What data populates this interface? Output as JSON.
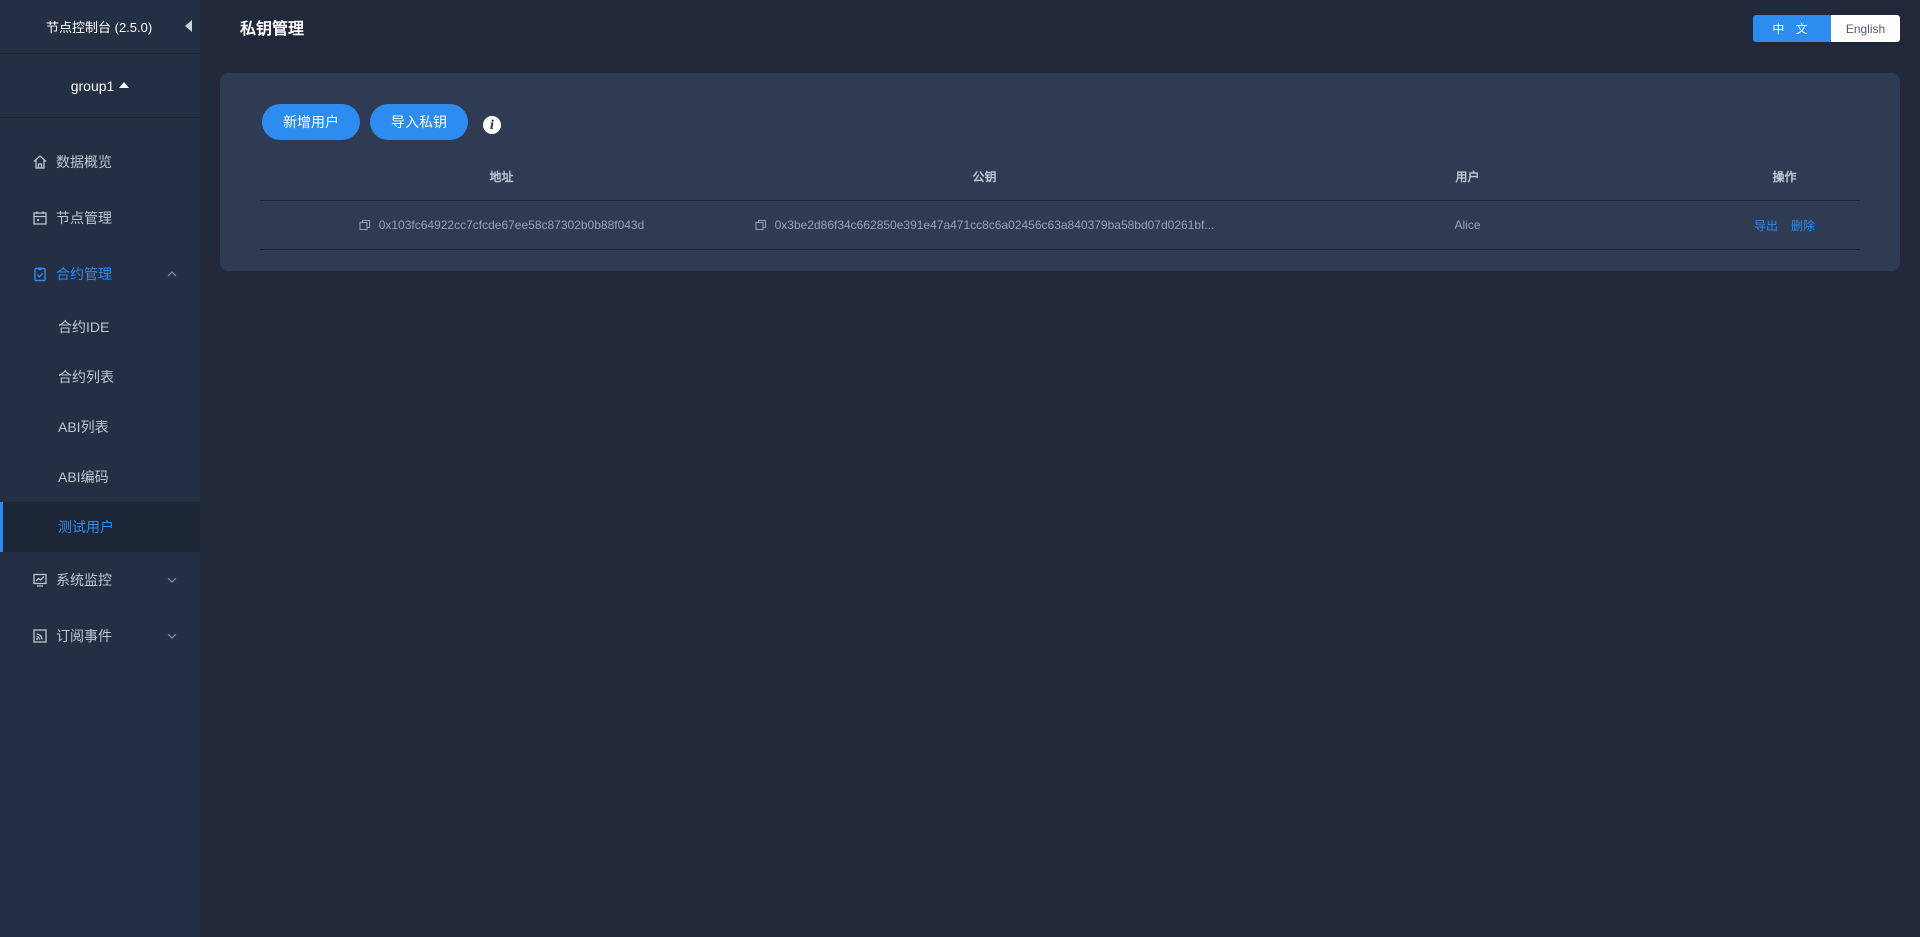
{
  "sidebar": {
    "title": "节点控制台 (2.5.0)",
    "group": "group1",
    "menu": [
      {
        "label": "数据概览",
        "icon": "home-icon"
      },
      {
        "label": "节点管理",
        "icon": "calendar-icon"
      },
      {
        "label": "合约管理",
        "icon": "clipboard-check-icon",
        "expanded": true,
        "children": [
          "合约IDE",
          "合约列表",
          "ABI列表",
          "ABI编码",
          "测试用户"
        ]
      },
      {
        "label": "系统监控",
        "icon": "monitor-icon"
      },
      {
        "label": "订阅事件",
        "icon": "rss-icon"
      }
    ],
    "active_item": "测试用户"
  },
  "header": {
    "title": "私钥管理",
    "lang_zh": "中 文",
    "lang_en": "English"
  },
  "toolbar": {
    "add_user": "新增用户",
    "import_key": "导入私钥"
  },
  "table": {
    "columns": [
      "地址",
      "公钥",
      "用户",
      "操作"
    ],
    "rows": [
      {
        "address": "0x103fc64922cc7cfcde67ee58c87302b0b88f043d",
        "public_key": "0x3be2d86f34c662850e391e47a471cc8c6a02456c63a840379ba58bd07d0261bf...",
        "user": "Alice",
        "actions": [
          "导出",
          "删除"
        ]
      }
    ]
  },
  "colors": {
    "accent": "#2d8cf0",
    "background": "#20283a",
    "sidebar": "#242f44",
    "card": "#2f3b53"
  }
}
